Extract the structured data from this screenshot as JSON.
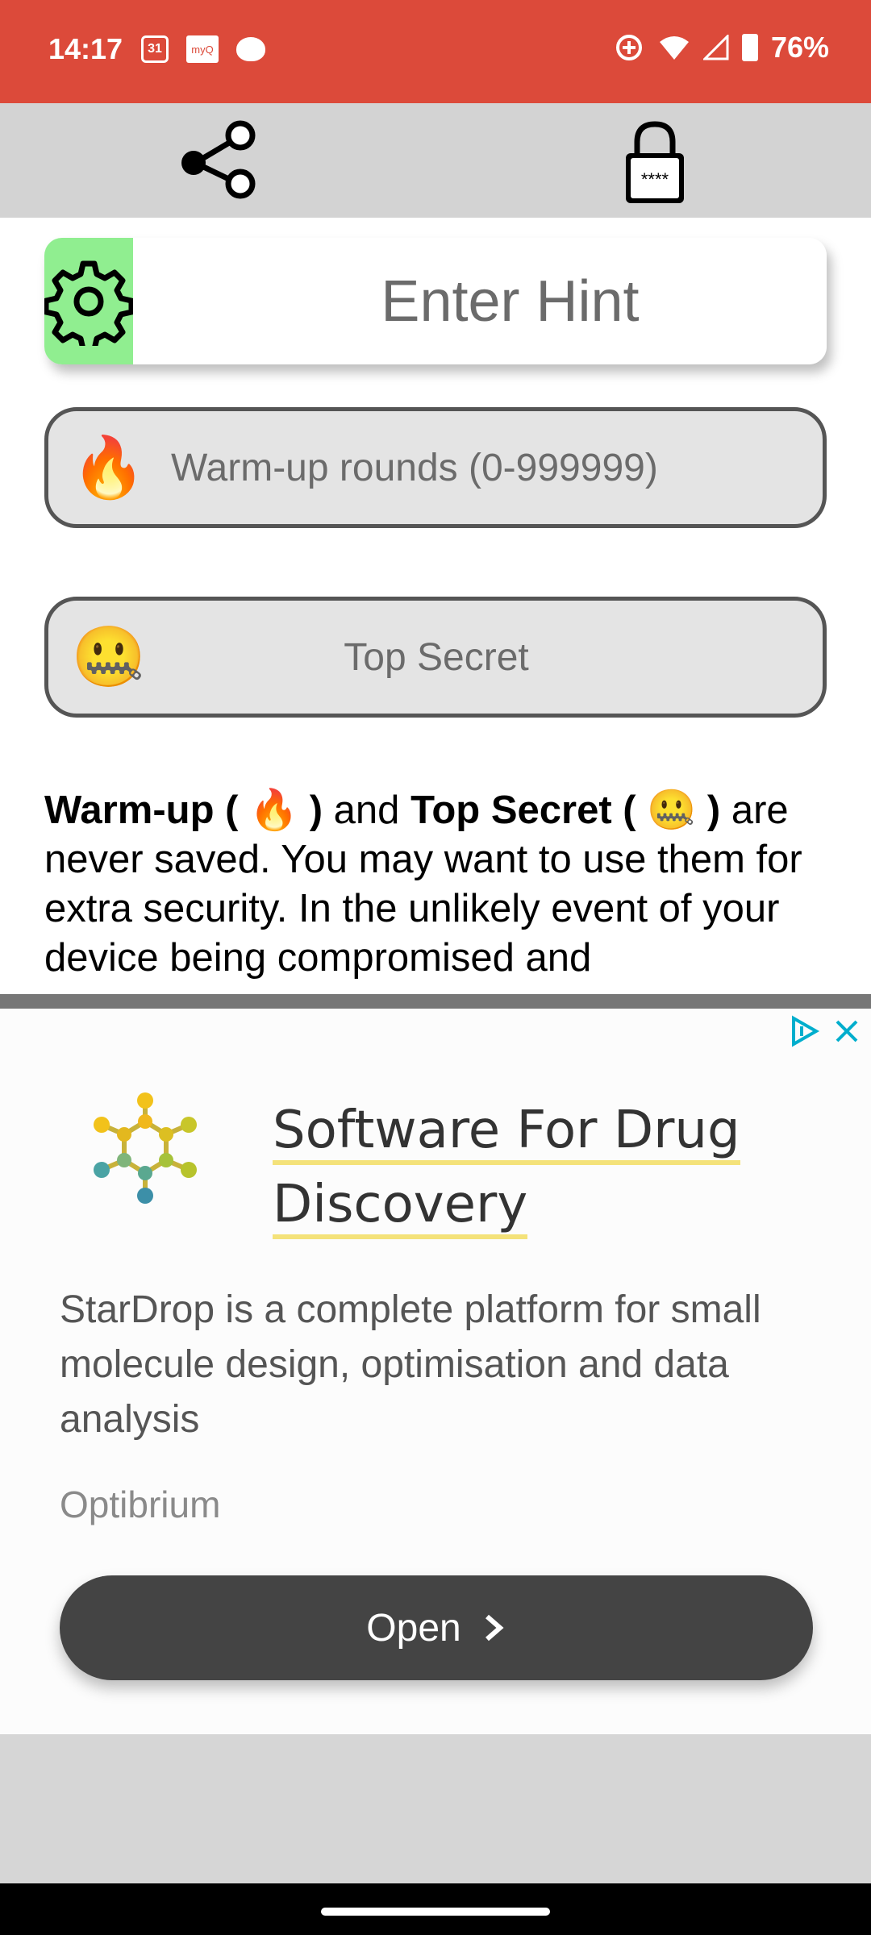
{
  "status_bar": {
    "time": "14:17",
    "calendar_day": "31",
    "myq_label": "myQ",
    "battery": "76%"
  },
  "toolbar": {
    "share_icon": "share-icon",
    "lock_icon": "lock-icon",
    "lock_label": "****"
  },
  "hint": {
    "placeholder": "Enter Hint",
    "settings_icon": "gear-icon",
    "next_icon": "chevron-right-icon"
  },
  "warmup": {
    "emoji": "🔥",
    "placeholder": "Warm-up rounds (0-999999)"
  },
  "secret": {
    "emoji": "🤐",
    "placeholder": "Top Secret"
  },
  "info": {
    "warmup_label": "Warm-up",
    "open_paren": "(",
    "warmup_emoji": "🔥",
    "close_paren": ")",
    "and": "and",
    "secret_label": "Top Secret",
    "secret_emoji": "🤐",
    "rest": "are never saved. You may want to use them for extra security. In the unlikely event of your device being compromised and"
  },
  "ad": {
    "headline": "Software For Drug Discovery",
    "body": "StarDrop is a complete platform for small molecule design, optimisation and data analysis",
    "advertiser": "Optibrium",
    "cta": "Open",
    "colors": {
      "cta_bg": "#444444",
      "headline_underline": "#f4e27a"
    }
  },
  "colors": {
    "status_bar": "#dc4a3a",
    "toolbar": "#d3d3d3",
    "settings_bg": "#90ee90",
    "next_bg": "#add8e6"
  }
}
